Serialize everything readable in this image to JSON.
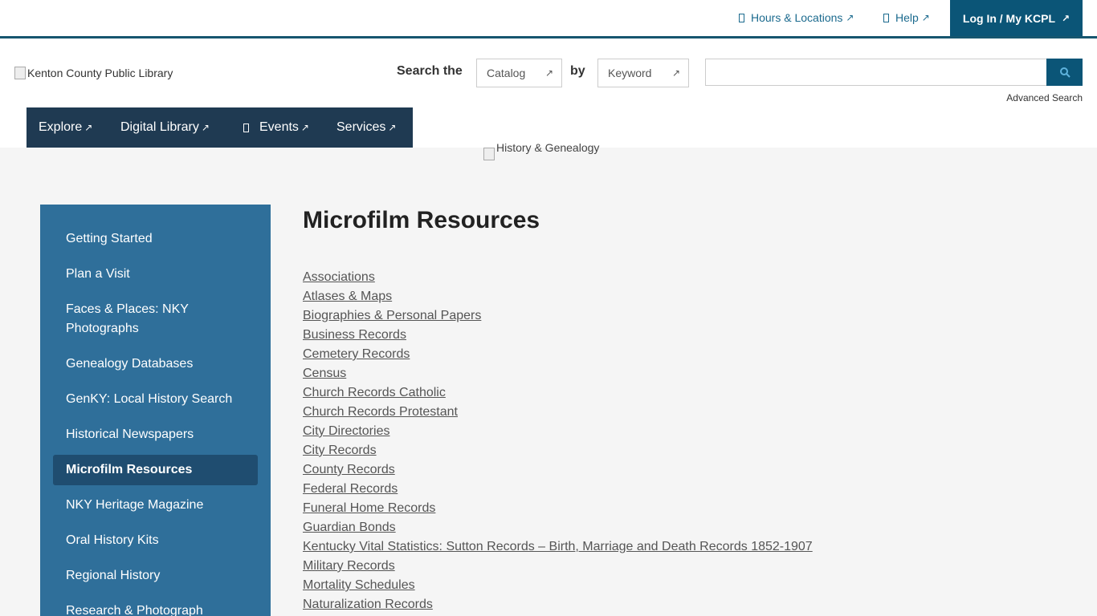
{
  "utility": {
    "hours_label": "Hours & Locations",
    "help_label": "Help",
    "login_label": "Log In / My KCPL",
    "ext_glyph": "↗"
  },
  "header": {
    "logo_alt": "Kenton County Public Library",
    "search_the_label": "Search the",
    "catalog_value": "Catalog",
    "by_label": "by",
    "keyword_value": "Keyword",
    "search_value": "",
    "advanced_search": "Advanced Search"
  },
  "nav": {
    "explore": "Explore",
    "digital_library": "Digital Library",
    "events": "Events",
    "services": "Services"
  },
  "banner": {
    "alt": "History & Genealogy"
  },
  "sidebar": {
    "items": [
      {
        "label": "Getting Started"
      },
      {
        "label": "Plan a Visit"
      },
      {
        "label": "Faces & Places: NKY Photographs"
      },
      {
        "label": "Genealogy Databases"
      },
      {
        "label": "GenKY: Local History Search"
      },
      {
        "label": "Historical Newspapers"
      },
      {
        "label": "Microfilm Resources"
      },
      {
        "label": "NKY Heritage Magazine"
      },
      {
        "label": "Oral History Kits"
      },
      {
        "label": "Regional History"
      },
      {
        "label": "Research & Photograph"
      }
    ]
  },
  "main": {
    "title": "Microfilm Resources",
    "links": [
      "Associations",
      "Atlases & Maps",
      "Biographies & Personal Papers",
      "Business Records",
      "Cemetery Records",
      "Census",
      "Church Records Catholic",
      "Church Records Protestant",
      "City Directories",
      "City Records",
      "County Records",
      "Federal Records",
      "Funeral Home Records",
      "Guardian Bonds",
      "Kentucky Vital Statistics: Sutton Records – Birth, Marriage and Death Records 1852-1907",
      "Military Records",
      "Mortality Schedules",
      "Naturalization Records"
    ]
  },
  "colors": {
    "accent": "#0b5577",
    "sidebar": "#2f6f9a",
    "sidebar_active": "#1f4d70",
    "nav_bg": "#1f3a52"
  }
}
